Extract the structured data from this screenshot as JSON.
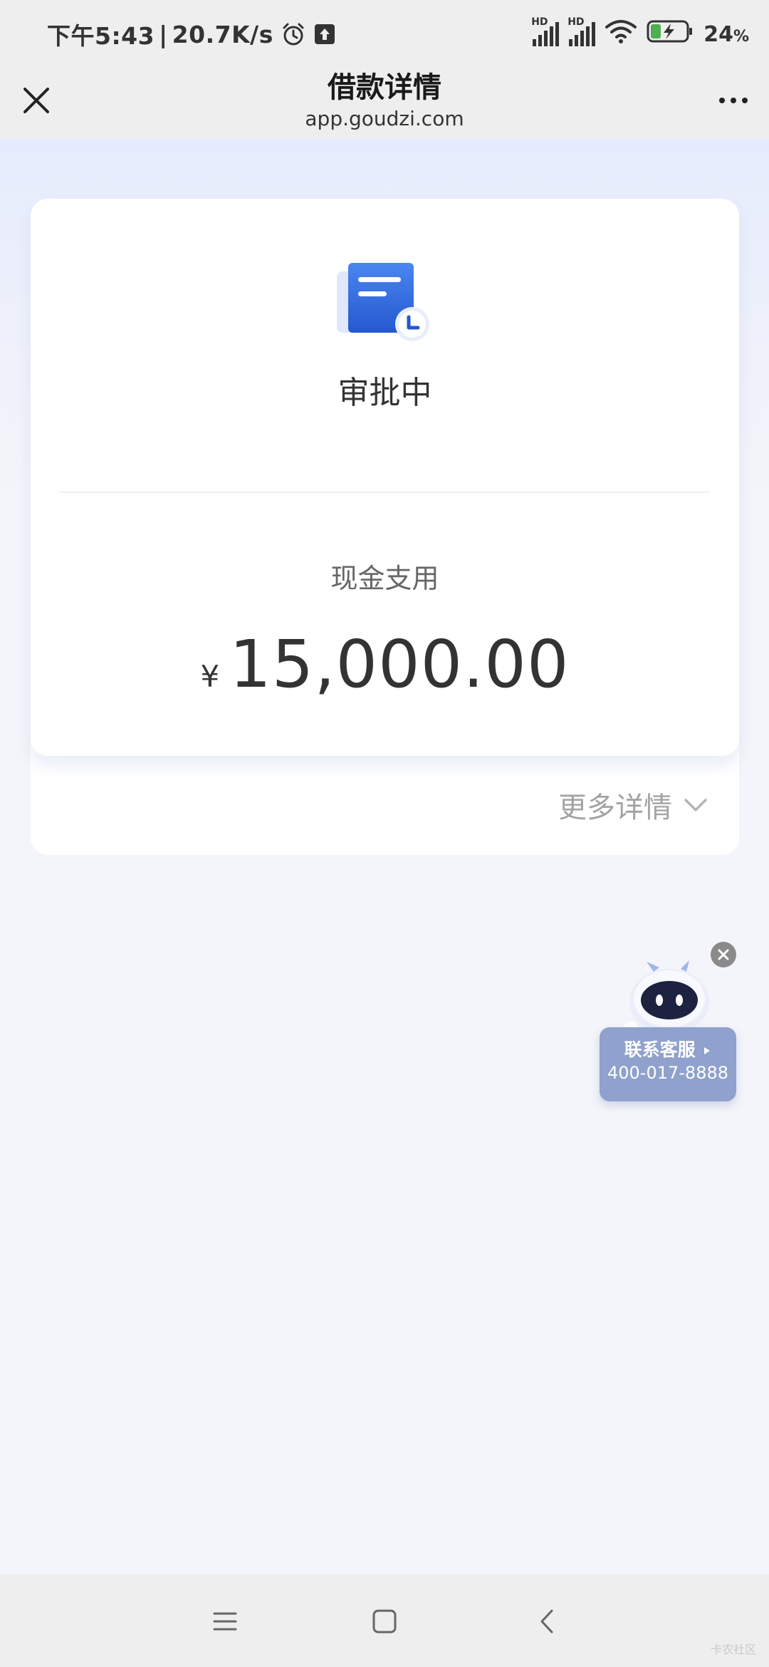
{
  "status_bar": {
    "time": "下午5:43",
    "net_speed": "20.7K/s",
    "battery_percent": "24",
    "battery_suffix": "%",
    "hd_label": "HD"
  },
  "nav": {
    "title": "借款详情",
    "subtitle": "app.goudzi.com"
  },
  "loan": {
    "status_label": "审批中",
    "purpose_label": "现金支用",
    "currency_symbol": "¥",
    "amount": "15,000.00",
    "more_details_label": "更多详情"
  },
  "service": {
    "contact_label": "联系客服",
    "phone": "400-017-8888"
  },
  "colors": {
    "accent_blue": "#2f6fe0",
    "service_bg": "#8fa1cc"
  },
  "watermark": "卡农社区"
}
